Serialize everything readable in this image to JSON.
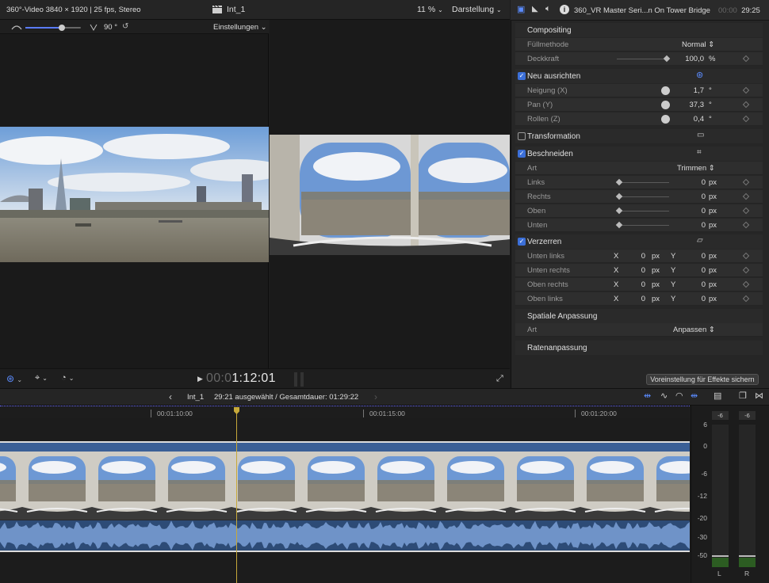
{
  "viewer": {
    "clip_info": "360°-Video 3840 × 1920 | 25 fps, Stereo",
    "project_name": "Int_1",
    "zoom": "11 %",
    "view_menu": "Darstellung",
    "angle_value": "90 °",
    "settings_menu": "Einstellungen",
    "timecode_dim": "00:0",
    "timecode_main": "1:12:01"
  },
  "inspector": {
    "clip_name": "360_VR Master Seri...n On Tower Bridge",
    "duration_dim": "00:00",
    "duration_main": "29:25",
    "compositing": {
      "title": "Compositing",
      "blend_label": "Füllmethode",
      "blend_value": "Normal",
      "opacity_label": "Deckkraft",
      "opacity_value": "100,0",
      "opacity_unit": "%"
    },
    "reorient": {
      "title": "Neu ausrichten",
      "tilt_label": "Neigung (X)",
      "tilt_value": "1,7",
      "pan_label": "Pan (Y)",
      "pan_value": "37,3",
      "roll_label": "Rollen (Z)",
      "roll_value": "0,4",
      "deg": "°"
    },
    "transform": {
      "title": "Transformation"
    },
    "crop": {
      "title": "Beschneiden",
      "type_label": "Art",
      "type_value": "Trimmen",
      "rows": [
        {
          "label": "Links",
          "value": "0"
        },
        {
          "label": "Rechts",
          "value": "0"
        },
        {
          "label": "Oben",
          "value": "0"
        },
        {
          "label": "Unten",
          "value": "0"
        }
      ],
      "unit": "px"
    },
    "distort": {
      "title": "Verzerren",
      "rows": [
        {
          "label": "Unten links"
        },
        {
          "label": "Unten rechts"
        },
        {
          "label": "Oben rechts"
        },
        {
          "label": "Oben links"
        }
      ],
      "x": "X",
      "y": "Y",
      "value": "0",
      "unit": "px"
    },
    "spatial": {
      "title": "Spatiale Anpassung",
      "type_label": "Art",
      "type_value": "Anpassen"
    },
    "rate": {
      "title": "Ratenanpassung"
    },
    "save_button": "Voreinstellung für Effekte sichern"
  },
  "timeline": {
    "project": "Int_1",
    "selection_info": "29:21 ausgewählt / Gesamtdauer: 01:29:22",
    "ruler": [
      "00:01:10:00",
      "00:01:15:00",
      "00:01:20:00"
    ]
  },
  "meters": {
    "peak_left": "-6",
    "peak_right": "-6",
    "scale": [
      "6",
      "0",
      "-6",
      "-12",
      "-20",
      "-30",
      "-50"
    ],
    "channel_left": "L",
    "channel_right": "R"
  },
  "colors": {
    "accent": "#3b6fd8",
    "playhead": "#c7a93a",
    "audio": "#2d4b76",
    "clip": "#3a5f96"
  }
}
